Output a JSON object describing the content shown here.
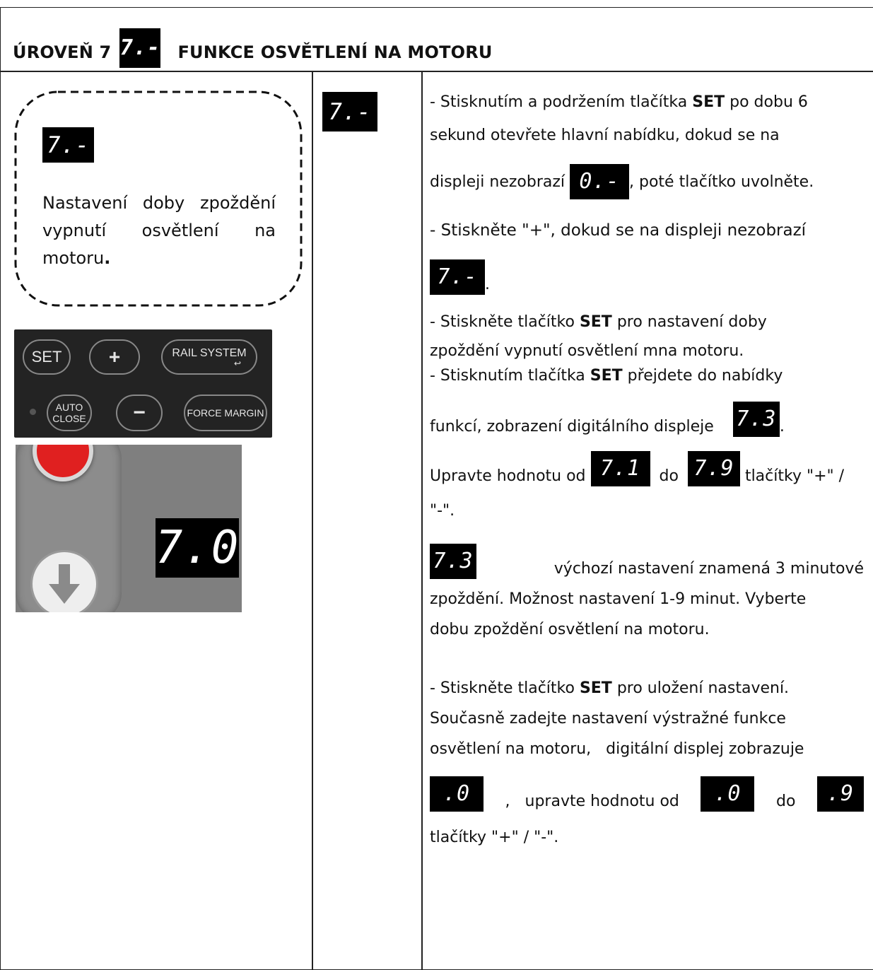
{
  "header": {
    "title_left": "ÚROVEŇ 7",
    "title_icon": "7.-",
    "title_right": "FUNKCE OSVĚTLENÍ NA MOTORU"
  },
  "left": {
    "display": "7.-",
    "note_line1_words": [
      "Nastavení",
      "doby",
      "zpoždění"
    ],
    "note_line2_words": [
      "vypnutí",
      "osvětlení",
      "na"
    ],
    "note_line3": "motoru",
    "note_line3_end": ".",
    "panel": {
      "set": "SET",
      "plus": "+",
      "rail_system": "RAIL SYSTEM",
      "auto": "AUTO",
      "close": "CLOSE",
      "minus": "−",
      "force_margin": "FORCE MARGIN"
    },
    "photo_display": "7.0"
  },
  "middle": {
    "display": "7.-"
  },
  "steps": {
    "p1a_prefix": "- Stisknutím a podržením tlačítka ",
    "p1a_set": "SET",
    "p1a_suffix": " po dobu 6",
    "p1b": "sekund otevřete hlavní nabídku, dokud se na",
    "p1c_prefix": "displeji nezobrazí ",
    "p1c_icon": "0.-",
    "p1c_suffix": ", poté tlačítko uvolněte.",
    "p2a": "- Stiskněte \"+\", dokud se na displeji nezobrazí",
    "p2_icon": "7.-",
    "p2_end": ".",
    "p3a_prefix": "-  Stiskněte tlačítko ",
    "p3a_set": "SET",
    "p3a_suffix": " pro nastavení doby",
    "p3b": "zpoždění vypnutí osvětlení mna motoru.",
    "p4a_prefix": "-  Stisknutím tlačítka ",
    "p4a_set": "SET",
    "p4a_suffix": " přejdete do nabídky",
    "p4b_prefix": "funkcí, zobrazení digitálního displeje ",
    "p4b_icon": "7.3",
    "p4b_end": ".",
    "p5_prefix": "Upravte hodnotu od ",
    "p5_icon_from": "7.1",
    "p5_mid": " do ",
    "p5_icon_to": "7.9",
    "p5_suffix": " tlačítky \"+\" /",
    "p5b": "\"-\".",
    "p6_icon": "7.3",
    "p6a": "výchozí nastavení znamená 3 minutové",
    "p6b": "zpoždění. Možnost nastavení 1-9 minut. Vyberte",
    "p6c": "dobu zpoždění osvětlení na motoru.",
    "p7a_prefix": "- Stiskněte tlačítko ",
    "p7a_set": "SET",
    "p7a_suffix": " pro uložení nastavení.",
    "p7b": "Současně zadejte nastavení výstražné funkce",
    "p7c": "osvětlení na motoru,   digitální displej zobrazuje",
    "p7d_icon1": ".0",
    "p7d_mid": ",   upravte hodnotu od",
    "p7d_icon2": ".0",
    "p7d_do": "do",
    "p7d_icon3": ".9",
    "p7e": "tlačítky \"+\" / \"-\"."
  }
}
